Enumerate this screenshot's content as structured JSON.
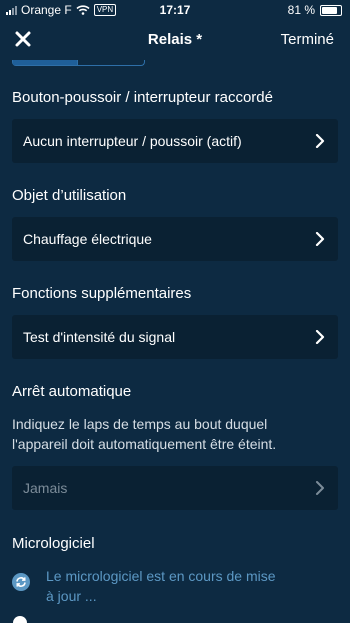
{
  "status_bar": {
    "carrier": "Orange F",
    "vpn": "VPN",
    "time": "17:17",
    "battery_label": "81 %",
    "battery_level": 0.81
  },
  "nav": {
    "title": "Relais *",
    "done_label": "Terminé"
  },
  "sections": {
    "button_switch": {
      "label": "Bouton-poussoir / interrupteur raccordé",
      "value": "Aucun interrupteur / poussoir (actif)"
    },
    "usage_object": {
      "label": "Objet d’utilisation",
      "value": "Chauffage électrique"
    },
    "extra_functions": {
      "label": "Fonctions supplémentaires",
      "value": "Test d'intensité du signal"
    },
    "auto_off": {
      "label": "Arrêt automatique",
      "description_line1": "Indiquez le laps de temps au bout duquel",
      "description_line2": "l'appareil doit automatiquement être éteint.",
      "value": "Jamais"
    },
    "firmware": {
      "label": "Micrologiciel",
      "status_line1": "Le micrologiciel est en cours de mise",
      "status_line2": "à jour ..."
    }
  },
  "colors": {
    "background": "#0d2a42",
    "row_background": "#0a2133",
    "accent": "#5c98c4",
    "disabled_text": "#7c8c99"
  }
}
